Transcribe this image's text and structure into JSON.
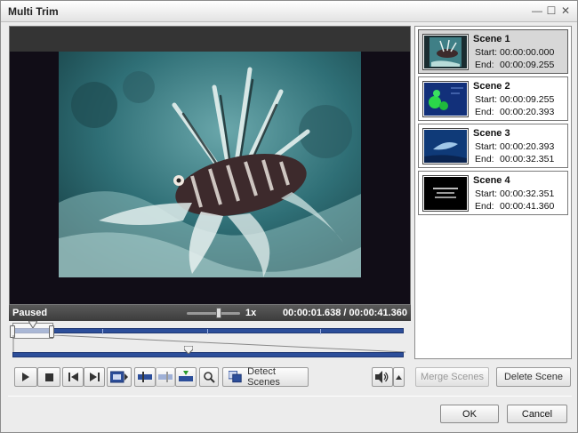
{
  "window": {
    "title": "Multi Trim"
  },
  "window_controls": {
    "minimize": "—",
    "maximize": "☐",
    "close": "✕"
  },
  "player": {
    "status": "Paused",
    "speed": "1x",
    "speed_fraction": 0.6,
    "timecode": "00:00:01.638 / 00:00:41.360"
  },
  "timeline": {
    "position_fraction": 0.04,
    "zoom_position_fraction": 0.45
  },
  "toolbar": {
    "play": "play-icon",
    "stop": "stop-icon",
    "prev_frame": "previous-frame-icon",
    "next_frame": "next-frame-icon",
    "detect_scenes_label": "Detect Scenes",
    "merge_scenes_label": "Merge Scenes",
    "delete_scene_label": "Delete Scene"
  },
  "scenes": [
    {
      "name": "Scene 1",
      "start_label": "Start:",
      "start": "00:00:00.000",
      "end_label": "End:",
      "end": "00:00:09.255"
    },
    {
      "name": "Scene 2",
      "start_label": "Start:",
      "start": "00:00:09.255",
      "end_label": "End:",
      "end": "00:00:20.393"
    },
    {
      "name": "Scene 3",
      "start_label": "Start:",
      "start": "00:00:20.393",
      "end_label": "End:",
      "end": "00:00:32.351"
    },
    {
      "name": "Scene 4",
      "start_label": "Start:",
      "start": "00:00:32.351",
      "end_label": "End:",
      "end": "00:00:41.360"
    }
  ],
  "dialog": {
    "ok_label": "OK",
    "cancel_label": "Cancel"
  },
  "colors": {
    "timeline_track": "#2c4e9a",
    "status_bar": "#4a4a4a",
    "video_tint": "#3f7f86"
  }
}
